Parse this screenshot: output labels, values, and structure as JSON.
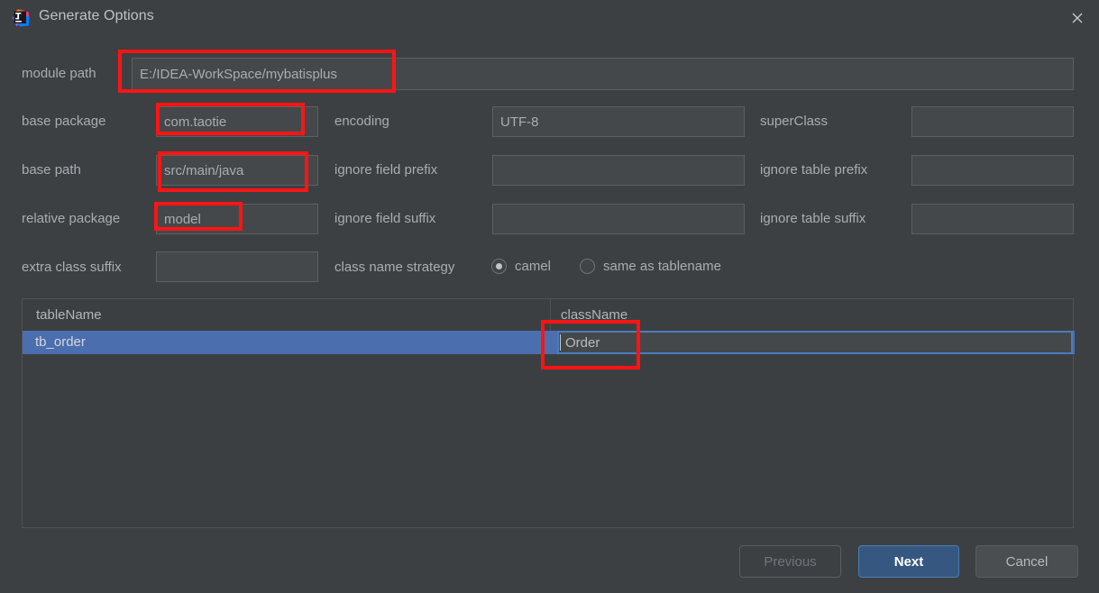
{
  "window": {
    "title": "Generate Options",
    "app_icon": "intellij-idea-icon",
    "close_icon": "close-icon"
  },
  "form": {
    "module_path": {
      "label": "module path",
      "value": "E:/IDEA-WorkSpace/mybatisplus",
      "placeholder": ""
    },
    "base_package": {
      "label": "base package",
      "value": "com.taotie",
      "placeholder": ""
    },
    "base_path": {
      "label": "base path",
      "value": "src/main/java",
      "placeholder": ""
    },
    "relative_package": {
      "label": "relative package",
      "value": "model",
      "placeholder": ""
    },
    "extra_class_suffix": {
      "label": "extra class suffix",
      "value": "",
      "placeholder": ""
    },
    "encoding": {
      "label": "encoding",
      "value": "UTF-8",
      "placeholder": ""
    },
    "ignore_field_prefix": {
      "label": "ignore field prefix",
      "value": "",
      "placeholder": ""
    },
    "ignore_field_suffix": {
      "label": "ignore field suffix",
      "value": "",
      "placeholder": ""
    },
    "super_class": {
      "label": "superClass",
      "value": "",
      "placeholder": ""
    },
    "ignore_table_prefix": {
      "label": "ignore table prefix",
      "value": "",
      "placeholder": ""
    },
    "ignore_table_suffix": {
      "label": "ignore table suffix",
      "value": "",
      "placeholder": ""
    },
    "class_name_strategy": {
      "label": "class name strategy",
      "options": [
        {
          "label": "camel",
          "selected": true
        },
        {
          "label": "same as tablename",
          "selected": false
        }
      ]
    }
  },
  "table": {
    "columns": [
      "tableName",
      "className"
    ],
    "rows": [
      {
        "tableName": "tb_order",
        "className": "Order",
        "selected": true,
        "editing": true
      }
    ]
  },
  "footer": {
    "previous_label": "Previous",
    "next_label": "Next",
    "cancel_label": "Cancel"
  },
  "colors": {
    "dialog_bg": "#3c4043",
    "field_bg": "#45484a",
    "field_border": "#5c6063",
    "text": "#a9adb0",
    "selection_blue": "#4b6eaf",
    "primary_button": "#365880",
    "annotation_red": "#ff1414"
  }
}
